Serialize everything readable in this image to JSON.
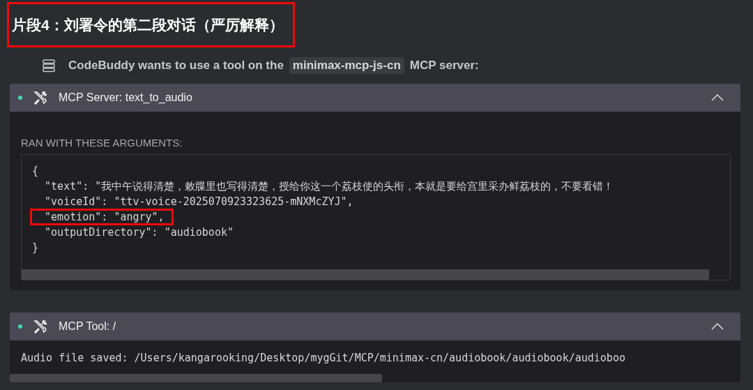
{
  "heading": {
    "text": "片段4：刘署令的第二段对话（严厉解释）",
    "highlighted": true
  },
  "request": {
    "prefix": "CodeBuddy wants to use a tool on the",
    "server": "minimax-mcp-js-cn",
    "suffix": "MCP server:"
  },
  "panels": [
    {
      "kind": "arguments",
      "title": "MCP Server: text_to_audio",
      "expanded": true,
      "section_label": "RAN WITH THESE ARGUMENTS:",
      "code_lines": [
        {
          "text": "{",
          "highlighted": false
        },
        {
          "text": "  \"text\": \"我中午说得清楚，敕牒里也写得清楚，授给你这一个荔枝使的头衔，本就是要给宫里采办鲜荔枝的，不要看错！",
          "highlighted": false
        },
        {
          "text": "  \"voiceId\": \"ttv-voice-2025070923323625-mNXMcZYJ\",",
          "highlighted": false
        },
        {
          "text": "  \"emotion\": \"angry\",",
          "highlighted": true
        },
        {
          "text": "  \"outputDirectory\": \"audiobook\"",
          "highlighted": false
        },
        {
          "text": "}",
          "highlighted": false
        }
      ]
    },
    {
      "kind": "output",
      "title": "MCP Tool: /",
      "expanded": true,
      "output": "Audio file saved: /Users/kangarooking/Desktop/mygGit/MCP/minimax-cn/audiobook/audiobook/audioboo"
    }
  ]
}
